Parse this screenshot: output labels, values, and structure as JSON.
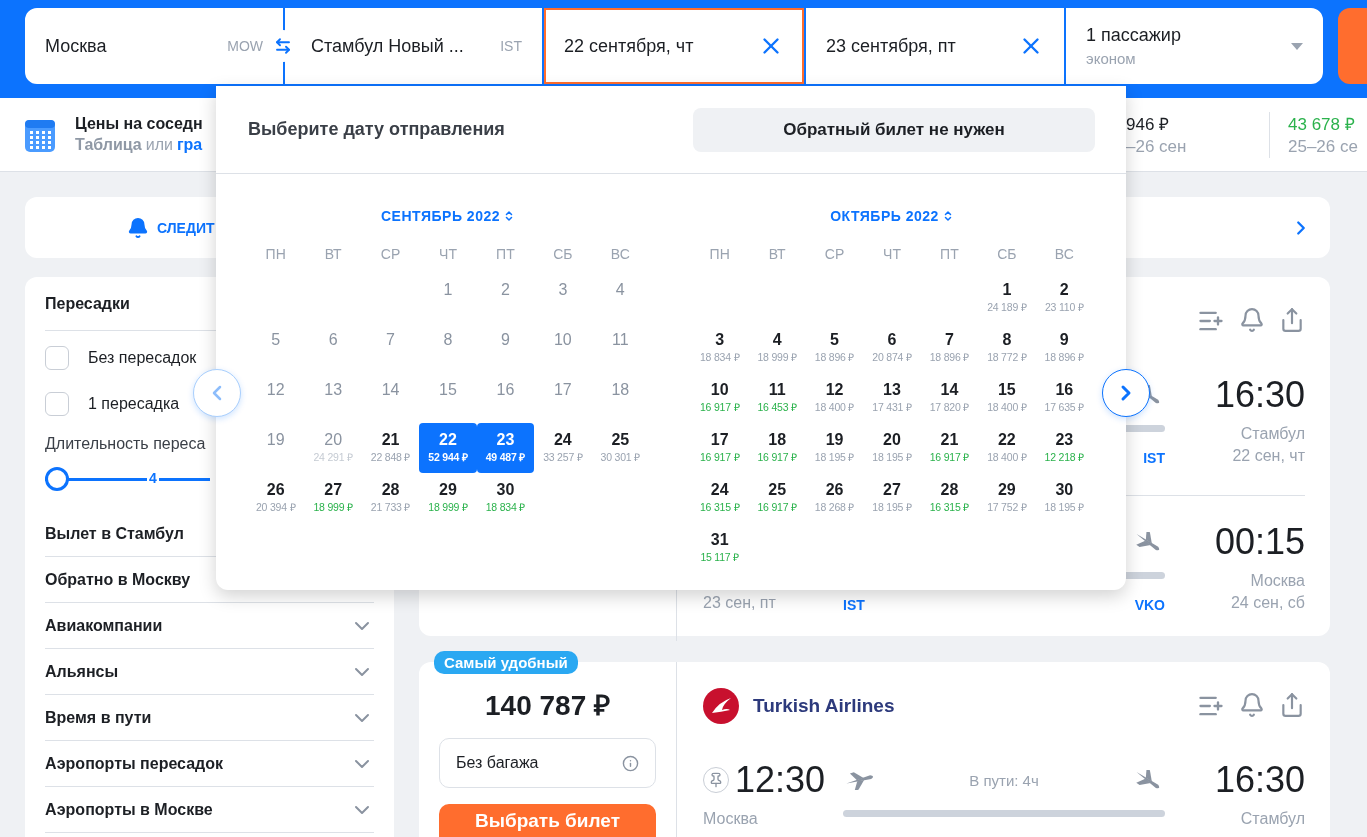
{
  "search_form": {
    "origin": {
      "city": "Москва",
      "code": "MOW"
    },
    "destination": {
      "city": "Стамбул Новый ...",
      "code": "IST"
    },
    "departure_date": {
      "value": "22 сентября, чт",
      "selected": true
    },
    "return_date": {
      "value": "23 сентября, пт",
      "selected": false
    },
    "passengers": {
      "count": "1 пассажир",
      "class": "эконом"
    }
  },
  "price_strip": {
    "title": "Цены на соседн",
    "table_link": "Таблица",
    "separator": "или",
    "graph_link": "гра",
    "prices": [
      {
        "price": "946 ₽",
        "dates": "–26 сен",
        "cheap": false
      },
      {
        "price": "43 678 ₽",
        "dates": "25–26 се",
        "cheap": true
      }
    ]
  },
  "subscribe": {
    "label": "СЛЕДИТ"
  },
  "filters": {
    "transfers": {
      "title": "Пересадки",
      "options": [
        {
          "label": "Без пересадок",
          "checked": false
        },
        {
          "label": "1 пересадка",
          "checked": false
        }
      ]
    },
    "duration": {
      "label": "Длительность переса",
      "value": "4",
      "level": 0
    },
    "plain_sections": [
      "Вылет в Стамбул",
      "Обратно в Москву"
    ],
    "sections": [
      {
        "label": "Авиакомпании",
        "expanded": false
      },
      {
        "label": "Альянсы",
        "expanded": false
      },
      {
        "label": "Время в пути",
        "expanded": false
      },
      {
        "label": "Аэропорты пересадок",
        "expanded": false
      },
      {
        "label": "Аэропорты в Москве",
        "expanded": false
      }
    ]
  },
  "tickets": [
    {
      "segments": [
        {
          "arrival_time": "16:30",
          "arrival_city": "Стамбул",
          "arrival_date": "22 сен, чт",
          "arrival_code": "IST"
        },
        {
          "departure_date": "23 сен, пт",
          "departure_code": "IST",
          "arrival_time": "00:15",
          "arrival_city": "Москва",
          "arrival_date": "24 сен, сб",
          "arrival_code": "VKO"
        }
      ]
    },
    {
      "badge": "Самый удобный",
      "price": "140 787 ₽",
      "baggage": "Без багажа",
      "buy_button": "Выбрать билет",
      "airline": "Turkish Airlines",
      "segments": [
        {
          "departure_time": "12:30",
          "departure_city": "Москва",
          "duration": "В пути: 4ч",
          "arrival_time": "16:30",
          "arrival_city": "Стамбул"
        }
      ]
    }
  ],
  "calendar": {
    "title": "Выберите дату отправления",
    "no_return_button": "Обратный билет не нужен",
    "months": [
      {
        "title": "СЕНТЯБРЬ 2022",
        "weekdays": [
          "ПН",
          "ВТ",
          "СР",
          "ЧТ",
          "ПТ",
          "СБ",
          "ВС"
        ],
        "days": [
          {
            "kind": "blank"
          },
          {
            "kind": "blank"
          },
          {
            "kind": "blank"
          },
          {
            "kind": "day",
            "day": "1",
            "disabled": true,
            "selected": false
          },
          {
            "kind": "day",
            "day": "2",
            "disabled": true,
            "selected": false
          },
          {
            "kind": "day",
            "day": "3",
            "disabled": true,
            "selected": false
          },
          {
            "kind": "day",
            "day": "4",
            "disabled": true,
            "selected": false
          },
          {
            "kind": "day",
            "day": "5",
            "disabled": true,
            "selected": false
          },
          {
            "kind": "day",
            "day": "6",
            "disabled": true,
            "selected": false
          },
          {
            "kind": "day",
            "day": "7",
            "disabled": true,
            "selected": false
          },
          {
            "kind": "day",
            "day": "8",
            "disabled": true,
            "selected": false
          },
          {
            "kind": "day",
            "day": "9",
            "disabled": true,
            "selected": false
          },
          {
            "kind": "day",
            "day": "10",
            "disabled": true,
            "selected": false
          },
          {
            "kind": "day",
            "day": "11",
            "disabled": true,
            "selected": false
          },
          {
            "kind": "day",
            "day": "12",
            "disabled": true,
            "selected": false
          },
          {
            "kind": "day",
            "day": "13",
            "disabled": true,
            "selected": false
          },
          {
            "kind": "day",
            "day": "14",
            "disabled": true,
            "selected": false
          },
          {
            "kind": "day",
            "day": "15",
            "disabled": true,
            "selected": false
          },
          {
            "kind": "day",
            "day": "16",
            "disabled": true,
            "selected": false
          },
          {
            "kind": "day",
            "day": "17",
            "disabled": true,
            "selected": false
          },
          {
            "kind": "day",
            "day": "18",
            "disabled": true,
            "selected": false
          },
          {
            "kind": "day",
            "day": "19",
            "disabled": true,
            "selected": false
          },
          {
            "kind": "day",
            "day": "20",
            "price": "24 291 ₽",
            "cheap": false,
            "disabled": true,
            "selected": false
          },
          {
            "kind": "day",
            "day": "21",
            "price": "22 848 ₽",
            "cheap": false,
            "disabled": false,
            "selected": false
          },
          {
            "kind": "day",
            "day": "22",
            "price": "52 944 ₽",
            "cheap": false,
            "disabled": false,
            "selected": true
          },
          {
            "kind": "day",
            "day": "23",
            "price": "49 487 ₽",
            "cheap": false,
            "disabled": false,
            "selected": true
          },
          {
            "kind": "day",
            "day": "24",
            "price": "33 257 ₽",
            "cheap": false,
            "disabled": false,
            "selected": false
          },
          {
            "kind": "day",
            "day": "25",
            "price": "30 301 ₽",
            "cheap": false,
            "disabled": false,
            "selected": false
          },
          {
            "kind": "day",
            "day": "26",
            "price": "20 394 ₽",
            "cheap": false,
            "disabled": false,
            "selected": false
          },
          {
            "kind": "day",
            "day": "27",
            "price": "18 999 ₽",
            "cheap": true,
            "disabled": false,
            "selected": false
          },
          {
            "kind": "day",
            "day": "28",
            "price": "21 733 ₽",
            "cheap": false,
            "disabled": false,
            "selected": false
          },
          {
            "kind": "day",
            "day": "29",
            "price": "18 999 ₽",
            "cheap": true,
            "disabled": false,
            "selected": false
          },
          {
            "kind": "day",
            "day": "30",
            "price": "18 834 ₽",
            "cheap": true,
            "disabled": false,
            "selected": false
          }
        ]
      },
      {
        "title": "ОКТЯБРЬ 2022",
        "weekdays": [
          "ПН",
          "ВТ",
          "СР",
          "ЧТ",
          "ПТ",
          "СБ",
          "ВС"
        ],
        "days": [
          {
            "kind": "blank"
          },
          {
            "kind": "blank"
          },
          {
            "kind": "blank"
          },
          {
            "kind": "blank"
          },
          {
            "kind": "blank"
          },
          {
            "kind": "day",
            "day": "1",
            "price": "24 189 ₽",
            "cheap": false,
            "disabled": false,
            "selected": false
          },
          {
            "kind": "day",
            "day": "2",
            "price": "23 110 ₽",
            "cheap": false,
            "disabled": false,
            "selected": false
          },
          {
            "kind": "day",
            "day": "3",
            "price": "18 834 ₽",
            "cheap": false,
            "disabled": false,
            "selected": false
          },
          {
            "kind": "day",
            "day": "4",
            "price": "18 999 ₽",
            "cheap": false,
            "disabled": false,
            "selected": false
          },
          {
            "kind": "day",
            "day": "5",
            "price": "18 896 ₽",
            "cheap": false,
            "disabled": false,
            "selected": false
          },
          {
            "kind": "day",
            "day": "6",
            "price": "20 874 ₽",
            "cheap": false,
            "disabled": false,
            "selected": false
          },
          {
            "kind": "day",
            "day": "7",
            "price": "18 896 ₽",
            "cheap": false,
            "disabled": false,
            "selected": false
          },
          {
            "kind": "day",
            "day": "8",
            "price": "18 772 ₽",
            "cheap": false,
            "disabled": false,
            "selected": false
          },
          {
            "kind": "day",
            "day": "9",
            "price": "18 896 ₽",
            "cheap": false,
            "disabled": false,
            "selected": false
          },
          {
            "kind": "day",
            "day": "10",
            "price": "16 917 ₽",
            "cheap": true,
            "disabled": false,
            "selected": false
          },
          {
            "kind": "day",
            "day": "11",
            "price": "16 453 ₽",
            "cheap": true,
            "disabled": false,
            "selected": false
          },
          {
            "kind": "day",
            "day": "12",
            "price": "18 400 ₽",
            "cheap": false,
            "disabled": false,
            "selected": false
          },
          {
            "kind": "day",
            "day": "13",
            "price": "17 431 ₽",
            "cheap": false,
            "disabled": false,
            "selected": false
          },
          {
            "kind": "day",
            "day": "14",
            "price": "17 820 ₽",
            "cheap": false,
            "disabled": false,
            "selected": false
          },
          {
            "kind": "day",
            "day": "15",
            "price": "18 400 ₽",
            "cheap": false,
            "disabled": false,
            "selected": false
          },
          {
            "kind": "day",
            "day": "16",
            "price": "17 635 ₽",
            "cheap": false,
            "disabled": false,
            "selected": false
          },
          {
            "kind": "day",
            "day": "17",
            "price": "16 917 ₽",
            "cheap": true,
            "disabled": false,
            "selected": false
          },
          {
            "kind": "day",
            "day": "18",
            "price": "16 917 ₽",
            "cheap": true,
            "disabled": false,
            "selected": false
          },
          {
            "kind": "day",
            "day": "19",
            "price": "18 195 ₽",
            "cheap": false,
            "disabled": false,
            "selected": false
          },
          {
            "kind": "day",
            "day": "20",
            "price": "18 195 ₽",
            "cheap": false,
            "disabled": false,
            "selected": false
          },
          {
            "kind": "day",
            "day": "21",
            "price": "16 917 ₽",
            "cheap": true,
            "disabled": false,
            "selected": false
          },
          {
            "kind": "day",
            "day": "22",
            "price": "18 400 ₽",
            "cheap": false,
            "disabled": false,
            "selected": false
          },
          {
            "kind": "day",
            "day": "23",
            "price": "12 218 ₽",
            "cheap": true,
            "disabled": false,
            "selected": false
          },
          {
            "kind": "day",
            "day": "24",
            "price": "16 315 ₽",
            "cheap": true,
            "disabled": false,
            "selected": false
          },
          {
            "kind": "day",
            "day": "25",
            "price": "16 917 ₽",
            "cheap": true,
            "disabled": false,
            "selected": false
          },
          {
            "kind": "day",
            "day": "26",
            "price": "18 268 ₽",
            "cheap": false,
            "disabled": false,
            "selected": false
          },
          {
            "kind": "day",
            "day": "27",
            "price": "18 195 ₽",
            "cheap": false,
            "disabled": false,
            "selected": false
          },
          {
            "kind": "day",
            "day": "28",
            "price": "16 315 ₽",
            "cheap": true,
            "disabled": false,
            "selected": false
          },
          {
            "kind": "day",
            "day": "29",
            "price": "17 752 ₽",
            "cheap": false,
            "disabled": false,
            "selected": false
          },
          {
            "kind": "day",
            "day": "30",
            "price": "18 195 ₽",
            "cheap": false,
            "disabled": false,
            "selected": false
          },
          {
            "kind": "day",
            "day": "31",
            "price": "15 117 ₽",
            "cheap": true,
            "disabled": false,
            "selected": false
          }
        ]
      }
    ]
  }
}
